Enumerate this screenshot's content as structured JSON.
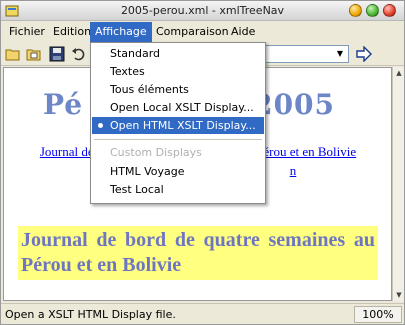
{
  "window": {
    "title": "2005-perou.xml - xmlTreeNav"
  },
  "menubar": {
    "items": [
      "Fichier",
      "Edition",
      "Affichage",
      "Comparaison",
      "Aide"
    ],
    "active": "Affichage"
  },
  "affichage_menu": {
    "items": [
      {
        "label": "Standard",
        "enabled": true,
        "checked": false
      },
      {
        "label": "Textes",
        "enabled": true,
        "checked": false
      },
      {
        "label": "Tous éléments",
        "enabled": true,
        "checked": false
      },
      {
        "label": "Open Local XSLT Display...",
        "enabled": true,
        "checked": false
      },
      {
        "label": "Open HTML XSLT Display...",
        "enabled": true,
        "checked": true,
        "highlighted": true
      },
      {
        "label": "Custom Displays",
        "enabled": false,
        "checked": false
      },
      {
        "label": "HTML Voyage",
        "enabled": true,
        "checked": false
      },
      {
        "label": "Test Local",
        "enabled": true,
        "checked": false
      }
    ]
  },
  "content": {
    "heading_left": "Pé",
    "heading_right": "2005",
    "link_line1_left": "Journal de b",
    "link_line1_right": "érou et en Bolivie",
    "link_line2_right": "n",
    "journal_title": "Journal de bord de quatre semaines au Pérou et en Bolivie"
  },
  "statusbar": {
    "message": "Open a XSLT HTML Display file.",
    "zoom": "100%"
  },
  "colors": {
    "heading": "#6d86c7",
    "journal_bg": "#ffff80",
    "journal_text": "#6f76c0",
    "menu_highlight": "#316ac5",
    "link": "#0000ee"
  },
  "icons": [
    "app-icon",
    "open-folder-icon",
    "open-file-icon",
    "save-icon",
    "undo-icon",
    "dropdown-arrow-icon",
    "go-arrow-icon",
    "scroll-up-icon",
    "scroll-down-icon"
  ]
}
